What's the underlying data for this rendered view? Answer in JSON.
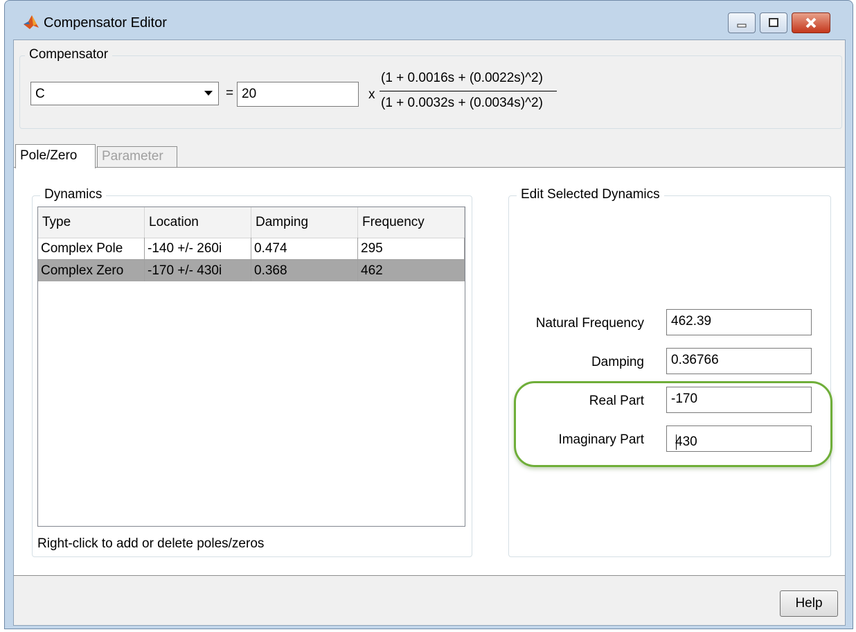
{
  "window": {
    "title": "Compensator Editor",
    "icons": [
      "matlab-logo-icon",
      "minimize-icon",
      "maximize-icon",
      "close-icon"
    ],
    "accent": "#c4371c"
  },
  "compensator": {
    "group_label": "Compensator",
    "selected": "C",
    "equals": "=",
    "gain": "20",
    "times": "x",
    "numerator": "(1 + 0.0016s + (0.0022s)^2)",
    "denominator": "(1 + 0.0032s + (0.0034s)^2)"
  },
  "tabs": [
    {
      "label": "Pole/Zero",
      "active": true
    },
    {
      "label": "Parameter",
      "active": false
    }
  ],
  "dynamics": {
    "group_label": "Dynamics",
    "columns": [
      "Type",
      "Location",
      "Damping",
      "Frequency"
    ],
    "rows": [
      {
        "type": "Complex Pole",
        "location": "-140 +/- 260i",
        "damping": "0.474",
        "frequency": "295"
      },
      {
        "type": "Complex Zero",
        "location": "-170 +/- 430i",
        "damping": "0.368",
        "frequency": "462"
      }
    ],
    "selected_row_color": "#a7a7a7",
    "hint": "Right-click to add or delete poles/zeros"
  },
  "edit": {
    "group_label": "Edit Selected Dynamics",
    "natural_frequency_label": "Natural Frequency",
    "natural_frequency": "462.39",
    "damping_label": "Damping",
    "damping": "0.36766",
    "real_part_label": "Real Part",
    "real_part": "-170",
    "imaginary_part_label": "Imaginary Part",
    "imaginary_part": "430",
    "highlight_color": "#6fae39"
  },
  "help_label": "Help"
}
